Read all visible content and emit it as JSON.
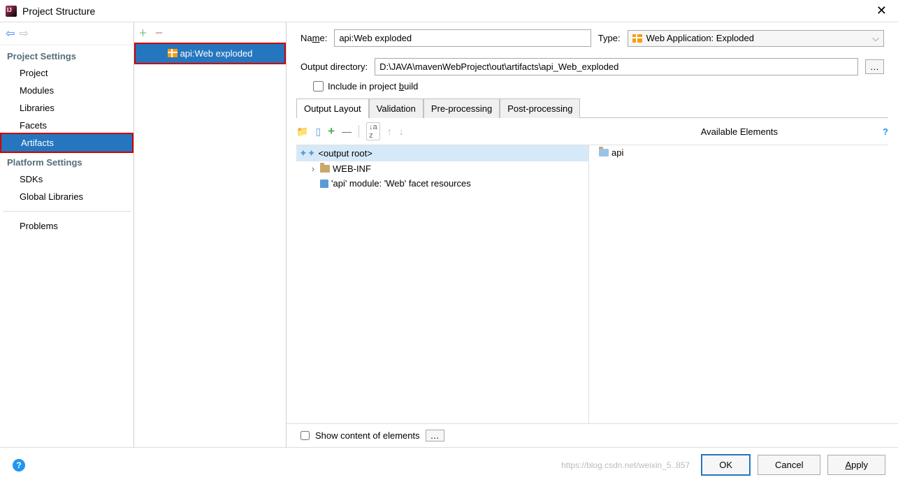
{
  "window": {
    "title": "Project Structure"
  },
  "sidebar": {
    "group1_header": "Project Settings",
    "group1": [
      "Project",
      "Modules",
      "Libraries",
      "Facets",
      "Artifacts"
    ],
    "group2_header": "Platform Settings",
    "group2": [
      "SDKs",
      "Global Libraries"
    ],
    "group3": [
      "Problems"
    ],
    "selected": "Artifacts"
  },
  "artifactList": {
    "items": [
      "api:Web exploded"
    ]
  },
  "form": {
    "name_label": "Name:",
    "name_value": "api:Web exploded",
    "type_label": "Type:",
    "type_value": "Web Application: Exploded",
    "outdir_label": "Output directory:",
    "outdir_value": "D:\\JAVA\\mavenWebProject\\out\\artifacts\\api_Web_exploded",
    "include_label": "Include in project build"
  },
  "tabs": [
    "Output Layout",
    "Validation",
    "Pre-processing",
    "Post-processing"
  ],
  "activeTab": "Output Layout",
  "availableHeader": "Available Elements",
  "tree": {
    "root": "<output root>",
    "webinf": "WEB-INF",
    "facet": "'api' module: 'Web' facet resources",
    "rightRoot": "api"
  },
  "showContent": "Show content of elements",
  "buttons": {
    "ok": "OK",
    "cancel": "Cancel",
    "apply": "Apply"
  },
  "watermark": "https://blog.csdn.net/weixin_5..857"
}
